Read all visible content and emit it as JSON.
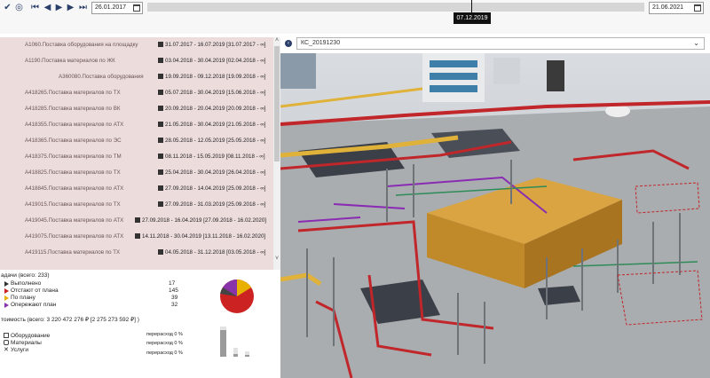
{
  "toolbar": {
    "icons": [
      "check-filter-icon",
      "settings-icon",
      "skip-back-icon",
      "prev-icon",
      "play-icon",
      "next-icon",
      "skip-forward-icon"
    ],
    "start_date": "26.01.2017",
    "end_date": "21.06.2021",
    "current_date": "07.12.2019"
  },
  "tasks": [
    {
      "name": "A1060.Поставка оборудования на площадку",
      "dates": "31.07.2017 - 16.07.2019  [31.07.2017 - ∞]"
    },
    {
      "name": "A1190.Поставка материалов по ЖК",
      "dates": "03.04.2018 - 30.04.2019  [02.04.2018 - ∞]"
    },
    {
      "name": "A360080.Поставка оборудования",
      "dates": "19.09.2018 - 09.12.2018  [19.09.2018 - ∞]"
    },
    {
      "name": "A418265.Поставка материалов по ТХ",
      "dates": "05.07.2018 - 30.04.2019  [15.06.2018 - ∞]"
    },
    {
      "name": "A418285.Поставка материалов по ВК",
      "dates": "20.09.2018 - 20.04.2019  [20.09.2018 - ∞]"
    },
    {
      "name": "A418355.Поставка материалов по АТХ",
      "dates": "21.05.2018 - 30.04.2019  [21.05.2018 - ∞]"
    },
    {
      "name": "A418365.Поставка материалов по ЭС",
      "dates": "28.05.2018 - 12.05.2019  [25.05.2018 - ∞]"
    },
    {
      "name": "A418375.Поставка материалов по ТМ",
      "dates": "08.11.2018 - 15.05.2019  [08.11.2018 - ∞]"
    },
    {
      "name": "A418825.Поставка материалов по ТХ",
      "dates": "25.04.2018 - 30.04.2019  [26.04.2018 - ∞]"
    },
    {
      "name": "A418845.Поставка материалов по АТХ",
      "dates": "27.09.2018 - 14.04.2019  [25.09.2018 - ∞]"
    },
    {
      "name": "A419015.Поставка материалов по ТХ",
      "dates": "27.09.2018 - 31.03.2019  [25.09.2018 - ∞]"
    },
    {
      "name": "A419045.Поставка материалов по АТХ",
      "dates": "27.09.2018 - 16.04.2019  [27.09.2018 - 16.02.2020]"
    },
    {
      "name": "A419075.Поставка материалов по АТХ",
      "dates": "14.11.2018 - 30.04.2019  [13.11.2018 - 16.02.2020]"
    },
    {
      "name": "A419115.Поставка материалов по ТХ",
      "dates": "04.05.2018 - 31.12.2018  [03.05.2018 - ∞]"
    }
  ],
  "stats": {
    "tasks_title": "адачи  (всего: 233)",
    "rows": [
      {
        "label": "Выполнено",
        "value": "17",
        "color": "#333333"
      },
      {
        "label": "Отстают от плана",
        "value": "145",
        "color": "#cc2222"
      },
      {
        "label": "По плану",
        "value": "39",
        "color": "#e8b000"
      },
      {
        "label": "Опережают план",
        "value": "32",
        "color": "#8833aa"
      }
    ],
    "cost_title": "тоимость  (всего:  3 220 472 276 ₽ [2 275 273 592 ₽] )",
    "categories": [
      {
        "label": "Оборудование",
        "icon": "equipment-icon",
        "note": "перерасход 0 %"
      },
      {
        "label": "Материалы",
        "icon": "materials-icon",
        "note": "перерасход 0 %"
      },
      {
        "label": "Услуги",
        "icon": "services-icon",
        "note": "перерасход 0 %"
      }
    ]
  },
  "model_select": {
    "value": "КС_20191230"
  }
}
